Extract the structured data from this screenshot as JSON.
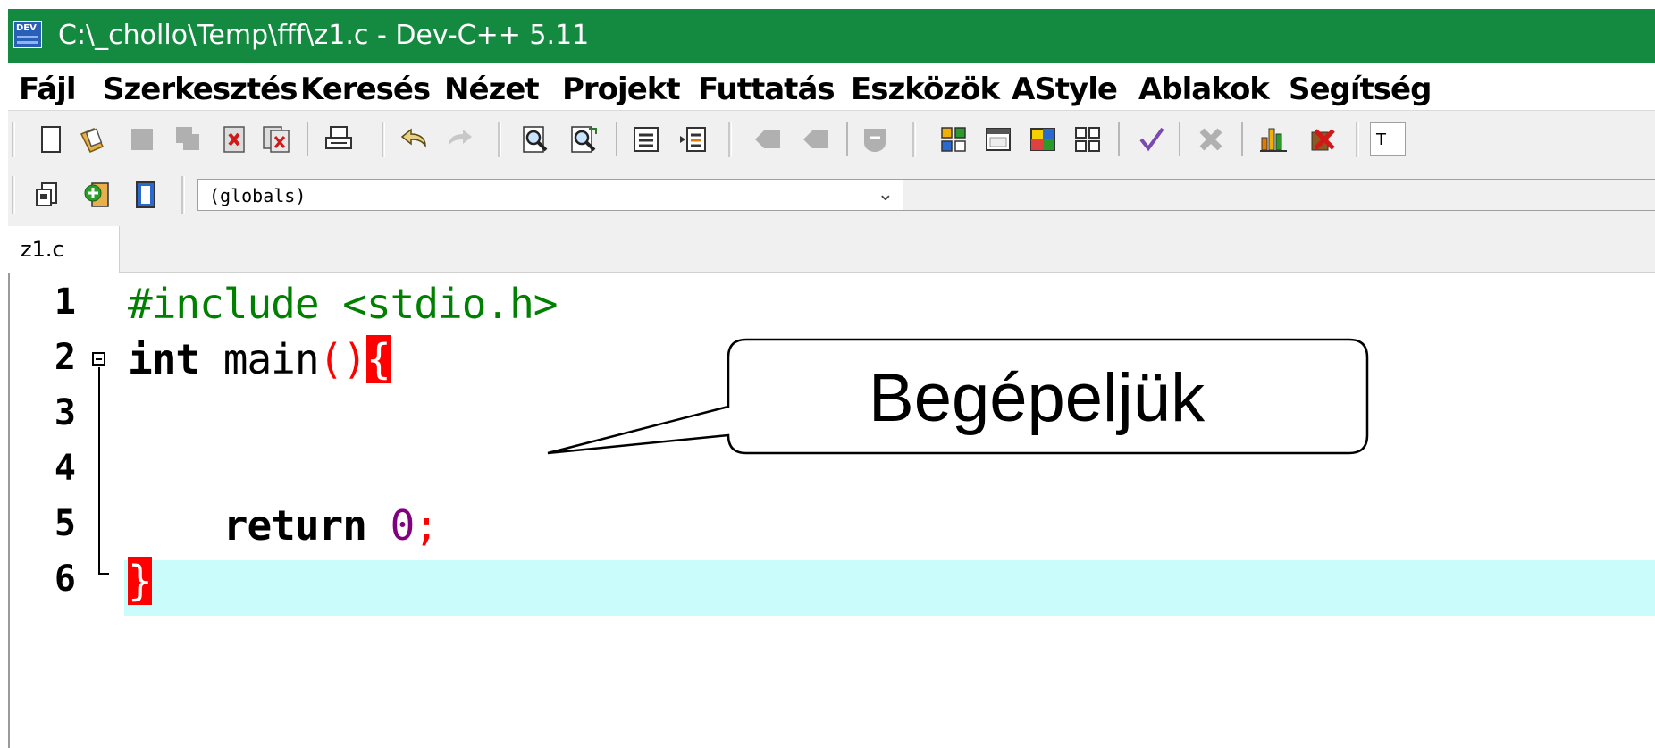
{
  "window": {
    "title": "C:\\_chollo\\Temp\\fff\\z1.c - Dev-C++ 5.11",
    "icon_text": "DEV",
    "accent": "#138a3f"
  },
  "menu": {
    "items": [
      "Fájl",
      "Szerkesztés",
      "Keresés",
      "Nézet",
      "Projekt",
      "Futtatás",
      "Eszközök",
      "AStyle",
      "Ablakok",
      "Segítség"
    ]
  },
  "toolbar": {
    "icons": [
      "new-file-icon",
      "open-file-icon",
      "save-icon",
      "save-all-icon",
      "close-file-icon",
      "close-all-icon",
      "print-icon",
      "undo-icon",
      "redo-icon",
      "find-icon",
      "replace-icon",
      "indent-icon",
      "unindent-icon",
      "bookmark-icon",
      "goto-bookmark-icon",
      "toggle-comment-icon",
      "compile-icon",
      "run-icon",
      "compile-run-icon",
      "rebuild-icon",
      "syntax-check-icon",
      "stop-icon",
      "chart-icon",
      "debug-icon"
    ],
    "scope_combo_value": "(globals)"
  },
  "tabs": [
    {
      "label": "z1.c"
    }
  ],
  "editor": {
    "line_numbers": [
      "1",
      "2",
      "3",
      "4",
      "5",
      "6"
    ],
    "lines": {
      "l1_preprocessor": "#include <stdio.h>",
      "l2_type": "int",
      "l2_name": " main",
      "l2_parens": "()",
      "l2_brace": "{",
      "l5_indent": "    ",
      "l5_keyword": "return",
      "l5_space": " ",
      "l5_number": "0",
      "l5_semicolon": ";",
      "l6_brace": "}"
    },
    "current_line_color": "#cbfcfc",
    "brace_match_color": "#ff0000"
  },
  "callout": {
    "text": "Begépeljük"
  }
}
